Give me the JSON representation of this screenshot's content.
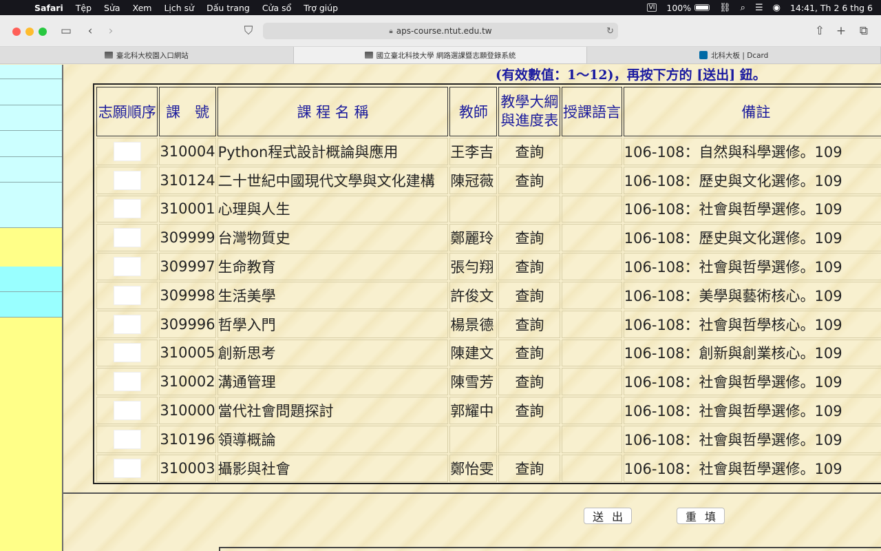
{
  "menubar": {
    "app": "Safari",
    "items": [
      "Tệp",
      "Sửa",
      "Xem",
      "Lịch sử",
      "Dấu trang",
      "Cửa sổ",
      "Trợ giúp"
    ],
    "input_source": "VI",
    "battery": "100%",
    "battery_level": 1.0,
    "clock": "14:41, Th 2 6 thg 6"
  },
  "browser": {
    "url": "aps-course.ntut.edu.tw",
    "tabs": [
      {
        "label": "臺北科大校園入口網站",
        "active": false
      },
      {
        "label": "國立臺北科技大學 網路選課暨志願登錄系統",
        "active": true
      },
      {
        "label": "北科大板 | Dcard",
        "active": false
      }
    ]
  },
  "page": {
    "notice": "(有效數值：1～12)，再按下方的 [送出] 鈕。",
    "headers": {
      "order": "志願順序",
      "code": "課　號",
      "name": "課 程 名 稱",
      "teacher": "教師",
      "syllabus_1": "教學大綱",
      "syllabus_2": "與進度表",
      "language": "授課語言",
      "note": "備註"
    },
    "rows": [
      {
        "code": "310004",
        "name": "Python程式設計概論與應用",
        "teacher": "王李吉",
        "syllabus": "查詢",
        "language": "",
        "note": "106-108：自然與科學選修。109"
      },
      {
        "code": "310124",
        "name": "二十世紀中國現代文學與文化建構",
        "teacher": "陳冠薇",
        "syllabus": "查詢",
        "language": "",
        "note": "106-108：歷史與文化選修。109"
      },
      {
        "code": "310001",
        "name": "心理與人生",
        "teacher": "",
        "syllabus": "",
        "language": "",
        "note": "106-108：社會與哲學選修。109"
      },
      {
        "code": "309999",
        "name": "台灣物質史",
        "teacher": "鄭麗玲",
        "syllabus": "查詢",
        "language": "",
        "note": "106-108：歷史與文化選修。109"
      },
      {
        "code": "309997",
        "name": "生命教育",
        "teacher": "張勻翔",
        "syllabus": "查詢",
        "language": "",
        "note": "106-108：社會與哲學選修。109"
      },
      {
        "code": "309998",
        "name": "生活美學",
        "teacher": "許俊文",
        "syllabus": "查詢",
        "language": "",
        "note": "106-108：美學與藝術核心。109"
      },
      {
        "code": "309996",
        "name": "哲學入門",
        "teacher": "楊景德",
        "syllabus": "查詢",
        "language": "",
        "note": "106-108：社會與哲學核心。109"
      },
      {
        "code": "310005",
        "name": "創新思考",
        "teacher": "陳建文",
        "syllabus": "查詢",
        "language": "",
        "note": "106-108：創新與創業核心。109"
      },
      {
        "code": "310002",
        "name": "溝通管理",
        "teacher": "陳雪芳",
        "syllabus": "查詢",
        "language": "",
        "note": "106-108：社會與哲學選修。109"
      },
      {
        "code": "310000",
        "name": "當代社會問題探討",
        "teacher": "郭耀中",
        "syllabus": "查詢",
        "language": "",
        "note": "106-108：社會與哲學選修。109"
      },
      {
        "code": "310196",
        "name": "領導概論",
        "teacher": "",
        "syllabus": "",
        "language": "",
        "note": "106-108：社會與哲學選修。109"
      },
      {
        "code": "310003",
        "name": "攝影與社會",
        "teacher": "鄭怡雯",
        "syllabus": "查詢",
        "language": "",
        "note": "106-108：社會與哲學選修。109"
      }
    ],
    "submit_label": "送出",
    "reset_label": "重填"
  }
}
